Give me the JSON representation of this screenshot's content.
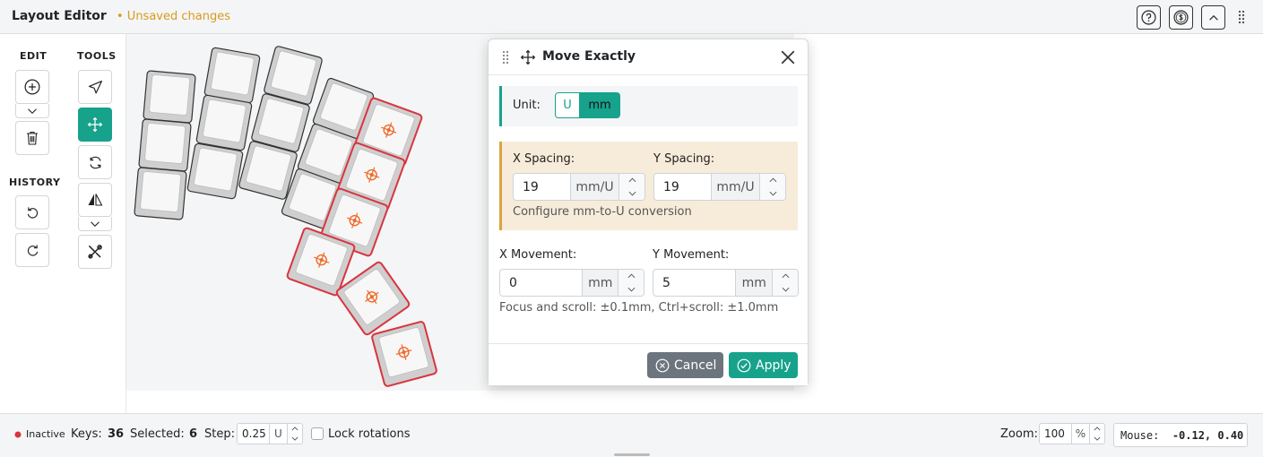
{
  "header": {
    "title": "Layout Editor",
    "unsaved": "• Unsaved changes",
    "buttons": [
      "help",
      "sponsor",
      "collapse"
    ]
  },
  "left_panel": {
    "edit_label": "EDIT",
    "tools_label": "TOOLS",
    "history_label": "HISTORY",
    "edit_buttons": [
      "add-key",
      "add-dropdown",
      "delete"
    ],
    "tool_buttons": [
      "select",
      "move",
      "rotate",
      "mirror",
      "mirror-dropdown",
      "tweak"
    ],
    "history_buttons": [
      "undo",
      "redo"
    ]
  },
  "dialog": {
    "title": "Move Exactly",
    "unit_label": "Unit:",
    "unit_options": [
      "U",
      "mm"
    ],
    "unit_selected": "mm",
    "x_spacing_label": "X Spacing:",
    "x_spacing_value": "19",
    "x_spacing_unit": "mm/U",
    "y_spacing_label": "Y Spacing:",
    "y_spacing_value": "19",
    "y_spacing_unit": "mm/U",
    "spacing_hint": "Configure mm-to-U conversion",
    "x_movement_label": "X Movement:",
    "x_movement_value": "0",
    "x_movement_unit": "mm",
    "y_movement_label": "Y Movement:",
    "y_movement_value": "5",
    "y_movement_unit": "mm",
    "movement_hint": "Focus and scroll: ±0.1mm, Ctrl+scroll: ±1.0mm",
    "cancel_label": "Cancel",
    "apply_label": "Apply"
  },
  "status": {
    "state": "Inactive",
    "keys_label": "Keys:",
    "keys_value": "36",
    "selected_label": "Selected:",
    "selected_value": "6",
    "step_label": "Step:",
    "step_value": "0.25",
    "step_unit": "U",
    "lock_label": "Lock rotations",
    "zoom_label": "Zoom:",
    "zoom_value": "100",
    "zoom_unit": "%",
    "mouse_label": "Mouse:",
    "mouse_value": "-0.12, 0.40"
  },
  "colors": {
    "accent": "#17a28c",
    "warning": "#d99a1e",
    "selected_key": "#d9343f",
    "key_center": "#f06a2a",
    "cancel": "#6c757d",
    "inactive_dot": "#d9343f"
  }
}
